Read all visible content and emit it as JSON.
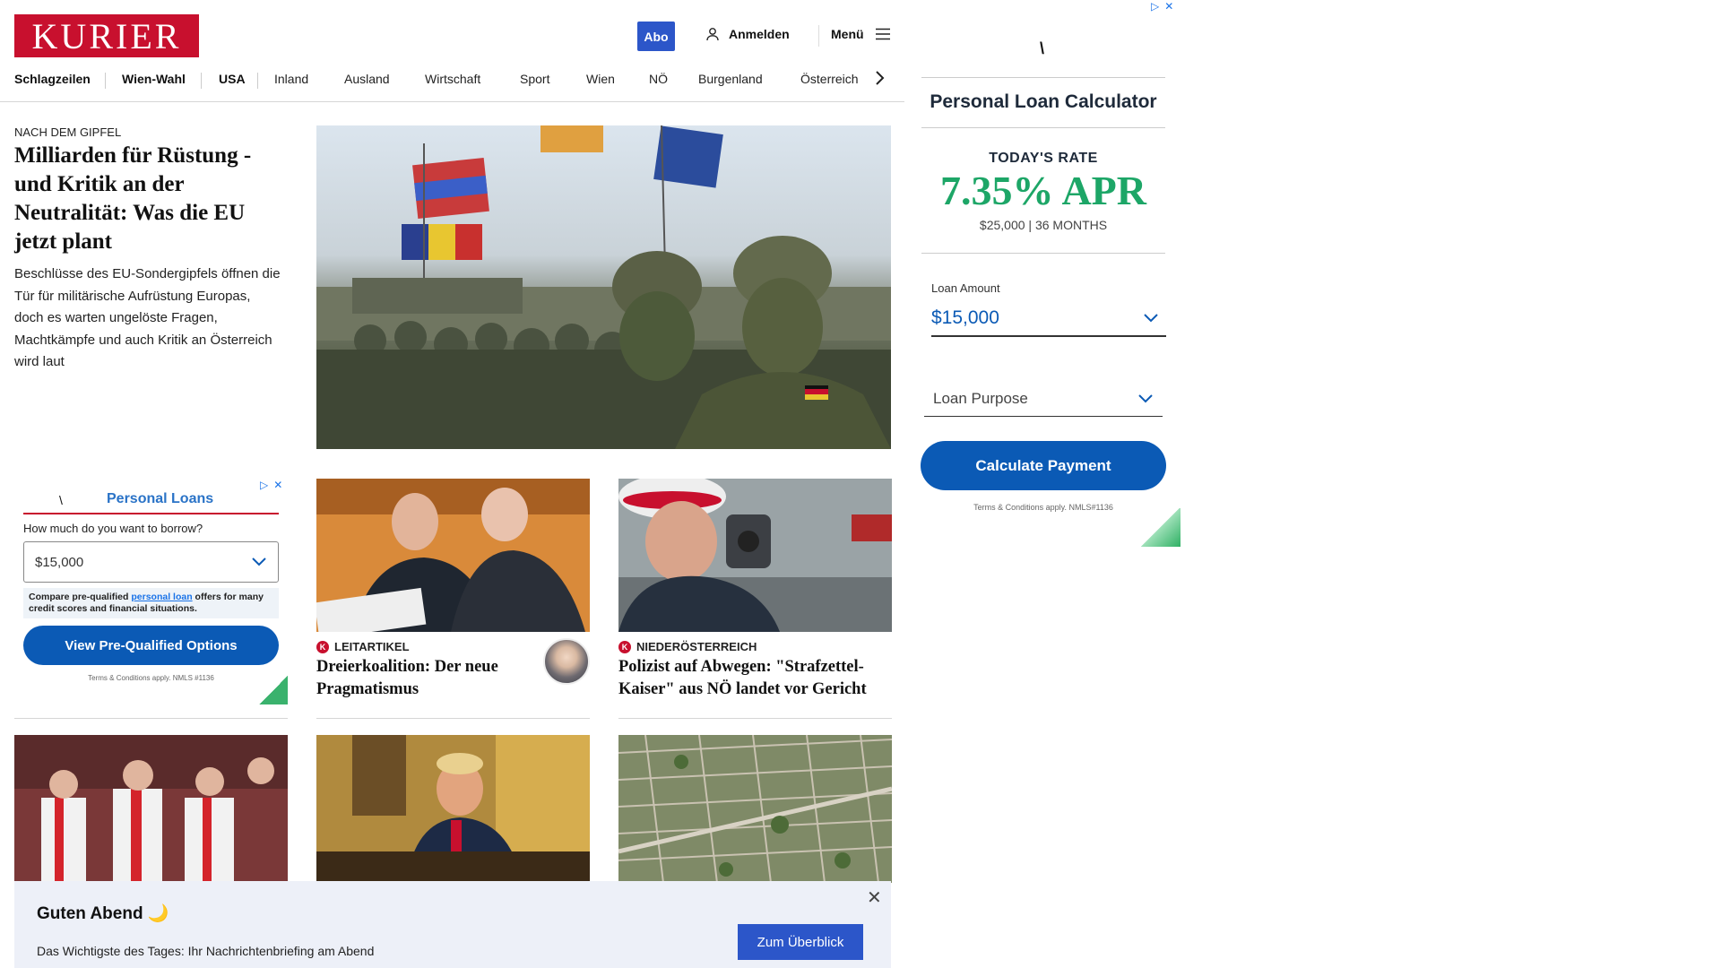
{
  "header": {
    "logo": "KURIER",
    "abo_label": "Abo",
    "login_label": "Anmelden",
    "menu_label": "Menü"
  },
  "nav": {
    "items": [
      "Schlagzeilen",
      "Wien-Wahl",
      "USA",
      "Inland",
      "Ausland",
      "Wirtschaft",
      "Sport",
      "Wien",
      "NÖ",
      "Burgenland",
      "Österreich"
    ],
    "bold": [
      true,
      true,
      true,
      false,
      false,
      false,
      false,
      false,
      false,
      false,
      false
    ]
  },
  "lead": {
    "kicker": "NACH DEM GIPFEL",
    "title": "Milliarden für Rüstung - und Kritik an der Neutralität: Was die EU jetzt plant",
    "teaser": "Beschlüsse des EU-Sondergipfels öffnen die Tür für militärische Aufrüstung Europas, doch es warten ungelöste Fragen, Machtkämpfe und auch Kritik an Österreich wird laut"
  },
  "ad_small": {
    "title": "Personal Loans",
    "question": "How much do you want to borrow?",
    "amount": "$15,000",
    "note_pre": "Compare pre-qualified ",
    "note_link": "personal loan",
    "note_post": " offers for many credit scores and financial situations.",
    "button": "View Pre-Qualified Options",
    "terms": "Terms & Conditions apply. NMLS #1136"
  },
  "cards": [
    {
      "kicker": "LEITARTIKEL",
      "title": "Dreierkoalition: Der neue Pragmatismus"
    },
    {
      "kicker": "NIEDERÖSTERREICH",
      "title": "Polizist auf Abwegen: \"Strafzettel-Kaiser\" aus NÖ landet vor Gericht"
    }
  ],
  "banner": {
    "title": "Guten Abend 🌙",
    "subtitle": "Das Wichtigste des Tages: Ihr Nachrichtenbriefing am Abend",
    "button": "Zum Überblick"
  },
  "ad_right": {
    "title": "Personal Loan Calculator",
    "rate_label": "TODAY'S RATE",
    "rate": "7.35% APR",
    "rate_terms": "$25,000 | 36 MONTHS",
    "amount_label": "Loan Amount",
    "amount": "$15,000",
    "purpose_placeholder": "Loan Purpose",
    "button": "Calculate Payment",
    "fine_print": "Terms & Conditions apply. NMLS#1136"
  },
  "colors": {
    "brand_red": "#c8102e",
    "accent_blue": "#2c56c9",
    "ad_green": "#1da667"
  }
}
